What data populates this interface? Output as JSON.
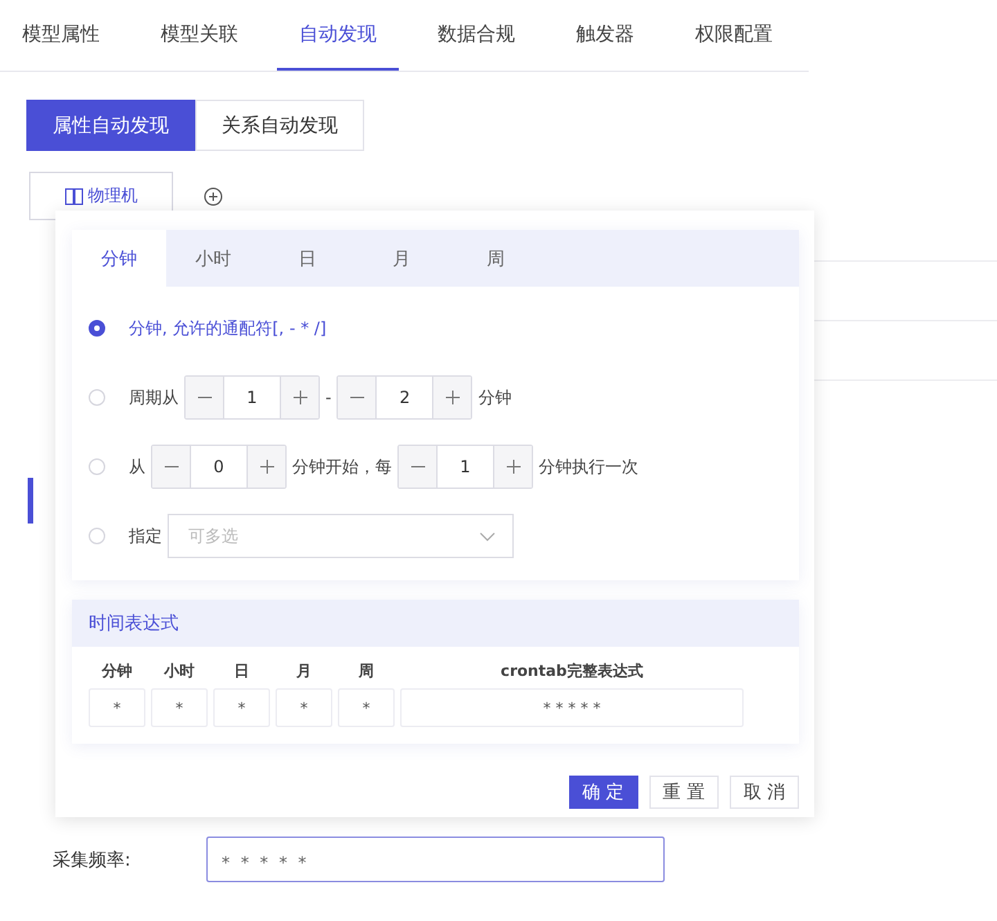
{
  "tabs": [
    {
      "label": "模型属性",
      "selected": false
    },
    {
      "label": "模型关联",
      "selected": false
    },
    {
      "label": "自动发现",
      "selected": true
    },
    {
      "label": "数据合规",
      "selected": false
    },
    {
      "label": "触发器",
      "selected": false
    },
    {
      "label": "权限配置",
      "selected": false
    }
  ],
  "subtabs": [
    {
      "label": "属性自动发现",
      "selected": true
    },
    {
      "label": "关系自动发现",
      "selected": false
    }
  ],
  "model_button": {
    "label": "物理机"
  },
  "form": {
    "label": "采集频率:",
    "value": "* * * * *"
  },
  "cron_popup": {
    "tabs": [
      {
        "label": "分钟",
        "selected": true
      },
      {
        "label": "小时",
        "selected": false
      },
      {
        "label": "日",
        "selected": false
      },
      {
        "label": "月",
        "selected": false
      },
      {
        "label": "周",
        "selected": false
      }
    ],
    "options": [
      {
        "kind": "text",
        "selected": true,
        "parts": [
          "分钟, 允许的通配符[, - * /]"
        ]
      },
      {
        "kind": "range",
        "selected": false,
        "parts": [
          "周期从",
          "-",
          "分钟"
        ],
        "values": [
          "1",
          "2"
        ]
      },
      {
        "kind": "interval",
        "selected": false,
        "parts": [
          "从",
          "分钟开始，每",
          "分钟执行一次"
        ],
        "values": [
          "0",
          "1"
        ]
      },
      {
        "kind": "select",
        "selected": false,
        "parts": [
          "指定"
        ],
        "placeholder": "可多选"
      }
    ],
    "expression": {
      "title": "时间表达式",
      "columns": [
        {
          "label": "分钟",
          "value": "*"
        },
        {
          "label": "小时",
          "value": "*"
        },
        {
          "label": "日",
          "value": "*"
        },
        {
          "label": "月",
          "value": "*"
        },
        {
          "label": "周",
          "value": "*"
        }
      ],
      "full": {
        "label": "crontab完整表达式",
        "value": "* * * * *"
      }
    },
    "buttons": [
      {
        "label": "确 定",
        "kind": "primary"
      },
      {
        "label": "重 置",
        "kind": "default"
      },
      {
        "label": "取 消",
        "kind": "default"
      }
    ]
  }
}
